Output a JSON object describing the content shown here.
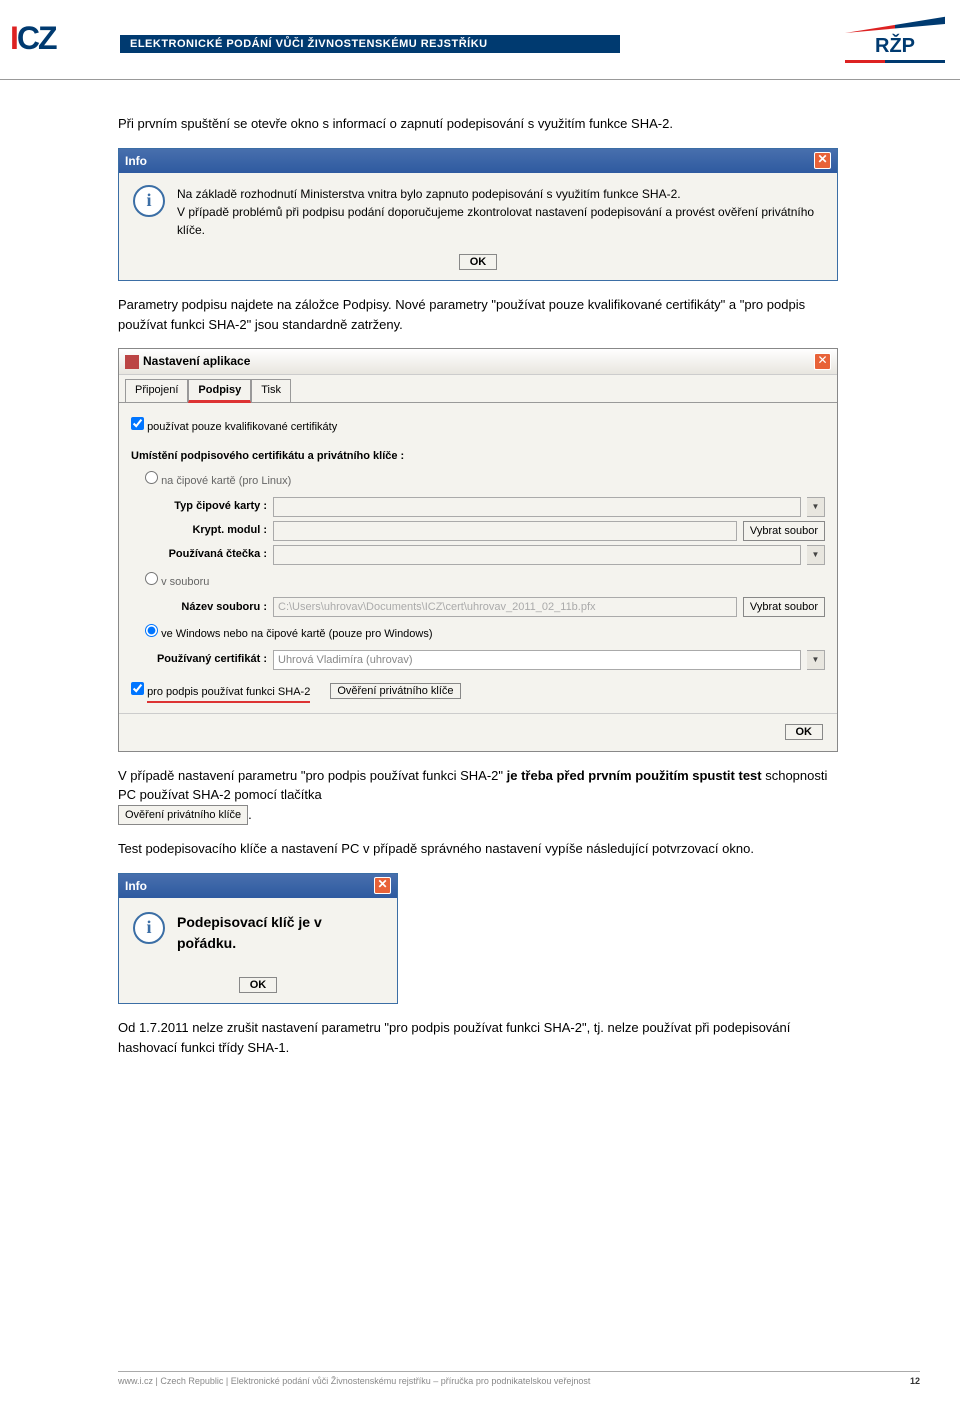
{
  "header": {
    "logo_left": "ICZ",
    "bar_title": "ELEKTRONICKÉ PODÁNÍ VŮČI ŽIVNOSTENSKÉMU REJSTŘÍKU",
    "logo_right": "RŽP"
  },
  "body": {
    "p1": "Při prvním spuštění se otevře okno s informací o zapnutí podepisování s využitím funkce SHA-2.",
    "info1": {
      "title": "Info",
      "line1": "Na základě rozhodnutí Ministerstva vnitra bylo zapnuto podepisování s využitím funkce SHA-2.",
      "line2": "V případě problémů při podpisu podání doporučujeme zkontrolovat nastavení podepisování a provést ověření privátního klíče.",
      "ok": "OK"
    },
    "p2": "Parametry podpisu najdete na záložce Podpisy. Nové parametry \"používat pouze kvalifikované certifikáty\" a \"pro podpis používat funkci SHA-2\" jsou standardně zatrženy.",
    "settings": {
      "title": "Nastavení aplikace",
      "tabs": [
        "Připojení",
        "Podpisy",
        "Tisk"
      ],
      "active_tab": "Podpisy",
      "chk1": "používat pouze kvalifikované certifikáty",
      "section1": "Umístění podpisového certifikátu a privátního klíče :",
      "radio_chip": "na čipové kartě (pro Linux)",
      "lbl_typ": "Typ čipové karty :",
      "lbl_modul": "Krypt. modul :",
      "lbl_ctecka": "Používaná čtečka :",
      "radio_file": "v souboru",
      "lbl_nazev": "Název souboru :",
      "file_value": "C:\\Users\\uhrovav\\Documents\\ICZ\\cert\\uhrovav_2011_02_11b.pfx",
      "btn_vybrat": "Vybrat soubor",
      "radio_win": "ve Windows nebo na čipové kartě (pouze pro Windows)",
      "lbl_cert": "Používaný certifikát :",
      "cert_value": "Uhrová Vladimíra (uhrovav)",
      "chk_sha2": "pro podpis používat funkci SHA-2",
      "btn_verify": "Ověření privátního klíče",
      "btn_ok": "OK"
    },
    "p3_a": "V případě nastavení parametru \"pro podpis používat funkci SHA-2\" ",
    "p3_b_bold": "je třeba před prvním použitím spustit test",
    "p3_c": " schopnosti PC používat SHA-2 pomocí tlačítka",
    "inline_btn": "Ověření privátního klíče",
    "p3_d": ".",
    "p4": "Test podepisovacího klíče a nastavení PC v případě správného nastavení vypíše následující potvrzovací okno.",
    "info2": {
      "title": "Info",
      "msg": "Podepisovací klíč je v pořádku.",
      "ok": "OK"
    },
    "p5": "Od 1.7.2011 nelze zrušit nastavení parametru \"pro podpis používat funkci SHA-2\", tj. nelze používat při podepisování hashovací funkci třídy SHA-1."
  },
  "footer": {
    "text": "www.i.cz | Czech Republic | Elektronické podání vůči Živnostenskému rejstříku – příručka pro podnikatelskou veřejnost",
    "page": "12"
  }
}
